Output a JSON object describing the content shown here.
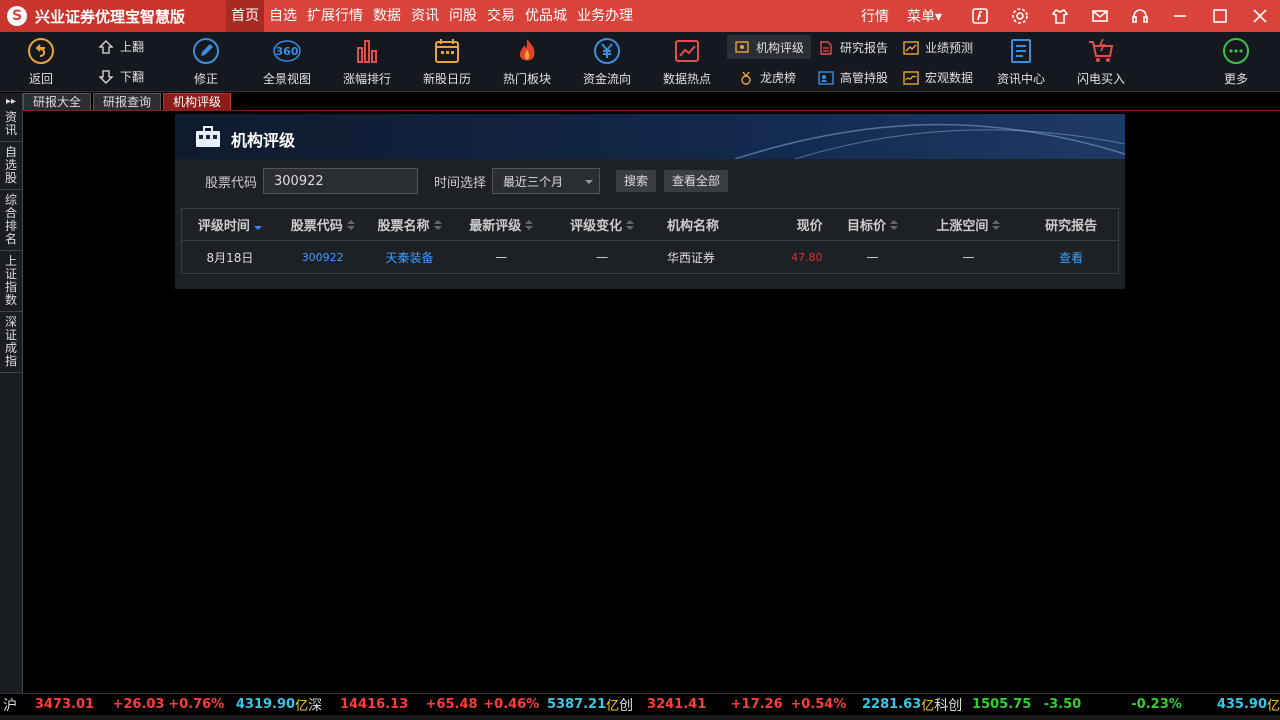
{
  "app": {
    "title": "兴业证券优理宝智慧版",
    "logo_glyph": "S"
  },
  "menu": [
    "首页",
    "自选",
    "扩展行情",
    "数据",
    "资讯",
    "问股",
    "交易",
    "优品城",
    "业务办理"
  ],
  "menu_active_index": 0,
  "title_right": {
    "quote": "行情",
    "menu": "菜单▾"
  },
  "toolbar": {
    "back": "返回",
    "page_up": "上翻",
    "page_down": "下翻",
    "edit": "修正",
    "panorama": "全景视图",
    "rank": "涨幅排行",
    "ipo_calendar": "新股日历",
    "hot_sector": "热门板块",
    "fund_flow": "资金流向",
    "data_hot": "数据热点",
    "inst_rating": "机构评级",
    "research_report": "研究报告",
    "earnings_forecast": "业绩预测",
    "dragon_tiger": "龙虎榜",
    "exec_holding": "高管持股",
    "macro_data": "宏观数据",
    "news_center": "资讯中心",
    "flash_buy": "闪电买入",
    "more": "更多"
  },
  "sidebar": [
    "资讯",
    "自选股",
    "综合排名",
    "上证指数",
    "深证成指"
  ],
  "tabs": [
    "研报大全",
    "研报查询",
    "机构评级"
  ],
  "tab_active_index": 2,
  "panel": {
    "title": "机构评级",
    "code_label": "股票代码",
    "code_value": "300922",
    "time_label": "时间选择",
    "time_value": "最近三个月",
    "search_btn": "搜索",
    "view_all_btn": "查看全部"
  },
  "table": {
    "headers": [
      "评级时间",
      "股票代码",
      "股票名称",
      "最新评级",
      "评级变化",
      "机构名称",
      "现价",
      "目标价",
      "上涨空间",
      "研究报告"
    ],
    "rows": [
      [
        "8月18日",
        "300922",
        "天秦装备",
        "—",
        "—",
        "华西证券",
        "47.80",
        "—",
        "—",
        "查看"
      ]
    ]
  },
  "ticker": [
    {
      "label": "沪",
      "price": "3473.01",
      "change": "+26.03",
      "pct": "+0.76%",
      "amount": "4319.90",
      "unit": "亿"
    },
    {
      "label": "深",
      "price": "14416.13",
      "change": "+65.48",
      "pct": "+0.46%",
      "amount": "5387.21",
      "unit": "亿"
    },
    {
      "label": "创",
      "price": "3241.41",
      "change": "+17.26",
      "pct": "+0.54%",
      "amount": "2281.63",
      "unit": "亿"
    },
    {
      "label": "科创",
      "price": "1505.75",
      "change": "-3.50",
      "pct": "-0.23%",
      "amount": "435.90",
      "unit": "亿"
    }
  ],
  "colors": {
    "title_bar": "#d9433a",
    "rise": "#ff3b3b",
    "fall": "#2fd12f",
    "link": "#3aa0ff",
    "active_tab": "#8c1d18"
  }
}
